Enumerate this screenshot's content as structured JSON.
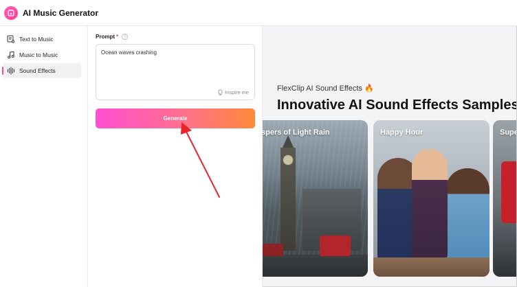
{
  "app": {
    "title": "AI Music Generator"
  },
  "sidebar": {
    "items": [
      {
        "label": "Text to Music",
        "icon": "text-to-music-icon",
        "active": false
      },
      {
        "label": "Music to Music",
        "icon": "music-note-icon",
        "active": false
      },
      {
        "label": "Sound Effects",
        "icon": "sound-wave-icon",
        "active": true
      }
    ]
  },
  "prompt": {
    "label": "Prompt",
    "required_mark": "*",
    "help": "?",
    "value": "Ocean waves crashing",
    "inspire_label": "Inspire me"
  },
  "generate": {
    "label": "Generate"
  },
  "showcase": {
    "subtitle": "FlexClip AI Sound Effects 🔥",
    "title": "Innovative AI Sound Effects Samples",
    "cards": [
      {
        "title": "spers of Light Rain"
      },
      {
        "title": "Happy Hour"
      },
      {
        "title": "Supe"
      }
    ]
  },
  "colors": {
    "accent": "#ff4f8b",
    "generate_gradient_start": "#ff4fd2",
    "generate_gradient_end": "#ff8a3a",
    "arrow": "#e8232a"
  }
}
